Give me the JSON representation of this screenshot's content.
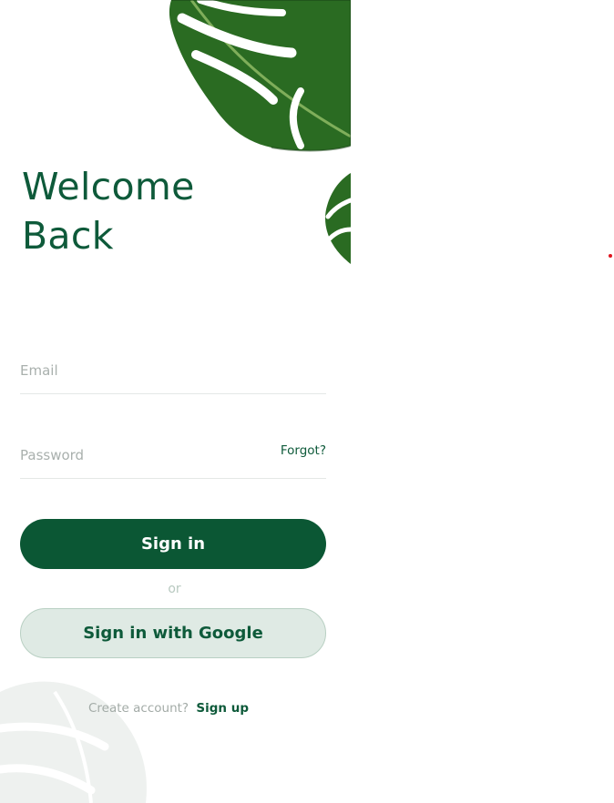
{
  "welcome": {
    "line1": "Welcome",
    "line2": "Back"
  },
  "form": {
    "email_placeholder": "Email",
    "password_placeholder": "Password",
    "forgot_label": "Forgot?"
  },
  "actions": {
    "signin_label": "Sign in",
    "or_label": "or",
    "google_label": "Sign in with Google"
  },
  "footer": {
    "create_text": "Create account?",
    "signup_label": "Sign up"
  },
  "colors": {
    "brand_green": "#0b5734",
    "google_bg": "#dfeae4",
    "leaf_dark": "#1f5e1c",
    "indicator": "#e0141e"
  },
  "icons": {
    "top_decoration": "monstera-leaf-icon",
    "side_decoration": "monstera-leaf-small-icon",
    "bottom_decoration": "faded-leaf-icon"
  }
}
